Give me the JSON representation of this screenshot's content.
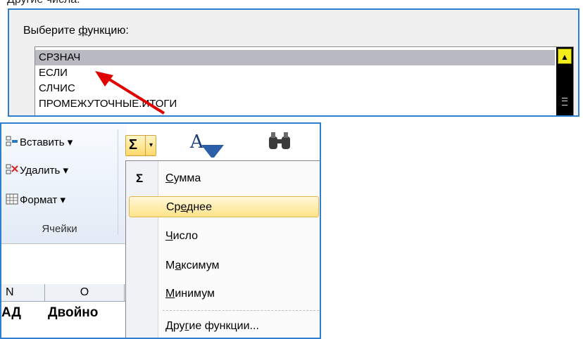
{
  "caption_top": "Другие числа:",
  "function_picker": {
    "label": "Выберите функцию:",
    "label_parts": {
      "before": "Выберите ",
      "underlined": "ф",
      "after": "ункцию:"
    },
    "items": [
      "СРЗНАЧ",
      "ЕСЛИ",
      "СЛЧИС",
      "ПРОМЕЖУТОЧНЫЕ.ИТОГИ"
    ],
    "selected_index": 0,
    "scroll_up_icon": "chevron-up-icon",
    "accent_color": "#2f7fd0",
    "highlight_color": "#b9b9c1"
  },
  "ribbon": {
    "cells_group": {
      "insert_label": "Вставить",
      "delete_label": "Удалить",
      "format_label": "Формат",
      "title": "Ячейки",
      "dropdown_glyph": "▾"
    },
    "autosum": {
      "sigma": "Σ",
      "drop_glyph": "▾"
    },
    "columns": [
      "N",
      "O"
    ],
    "cells": [
      "АД",
      "Двойно"
    ]
  },
  "autosum_menu": {
    "items": [
      {
        "label": "Сумма",
        "underline_index": 0,
        "icon": "Σ"
      },
      {
        "label": "Среднее",
        "underline_index": 2,
        "icon": ""
      },
      {
        "label": "Число",
        "underline_index": 0,
        "icon": ""
      },
      {
        "label": "Максимум",
        "underline_index": 1,
        "icon": ""
      },
      {
        "label": "Минимум",
        "underline_index": 0,
        "icon": ""
      },
      {
        "label": "Другие функции...",
        "underline_index": 3,
        "icon": ""
      }
    ],
    "highlighted_index": 1
  }
}
